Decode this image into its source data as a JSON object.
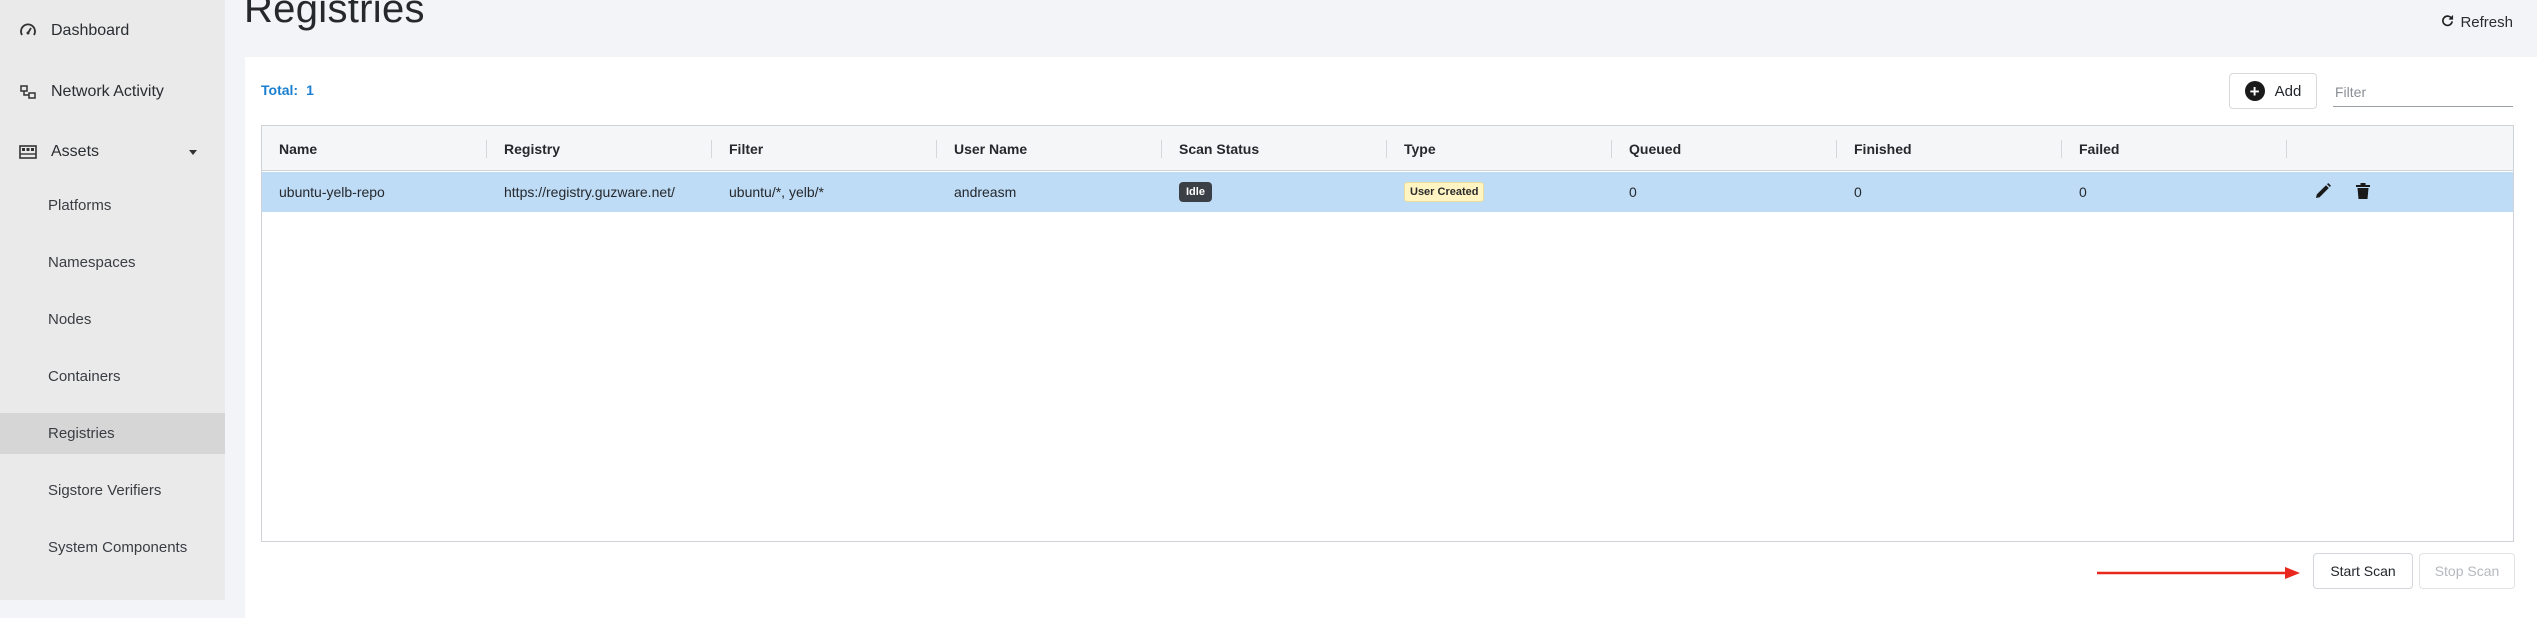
{
  "sidebar": {
    "top_items": [
      {
        "label": "Dashboard",
        "icon": "speedometer-icon"
      },
      {
        "label": "Network Activity",
        "icon": "network-icon"
      },
      {
        "label": "Assets",
        "icon": "assets-icon"
      }
    ],
    "sub_items": [
      {
        "label": "Platforms"
      },
      {
        "label": "Namespaces"
      },
      {
        "label": "Nodes"
      },
      {
        "label": "Containers"
      },
      {
        "label": "Registries"
      },
      {
        "label": "Sigstore Verifiers"
      },
      {
        "label": "System Components"
      }
    ],
    "active_item": "Registries"
  },
  "header": {
    "title": "Registries",
    "refresh_label": "Refresh"
  },
  "toolbar": {
    "total_label": "Total:",
    "total_count": "1",
    "add_label": "Add",
    "filter_placeholder": "Filter"
  },
  "table": {
    "columns": [
      "Name",
      "Registry",
      "Filter",
      "User Name",
      "Scan Status",
      "Type",
      "Queued",
      "Finished",
      "Failed"
    ],
    "rows": [
      {
        "name": "ubuntu-yelb-repo",
        "registry": "https://registry.guzware.net/",
        "filter": "ubuntu/*, yelb/*",
        "user_name": "andreasm",
        "scan_status": "Idle",
        "type": "User Created",
        "queued": "0",
        "finished": "0",
        "failed": "0"
      }
    ]
  },
  "footer": {
    "start_scan_label": "Start Scan",
    "stop_scan_label": "Stop Scan"
  },
  "colors": {
    "accent": "#1a7fd0",
    "selected_row": "#bfdcf6",
    "annotation_arrow": "#e8281c"
  }
}
